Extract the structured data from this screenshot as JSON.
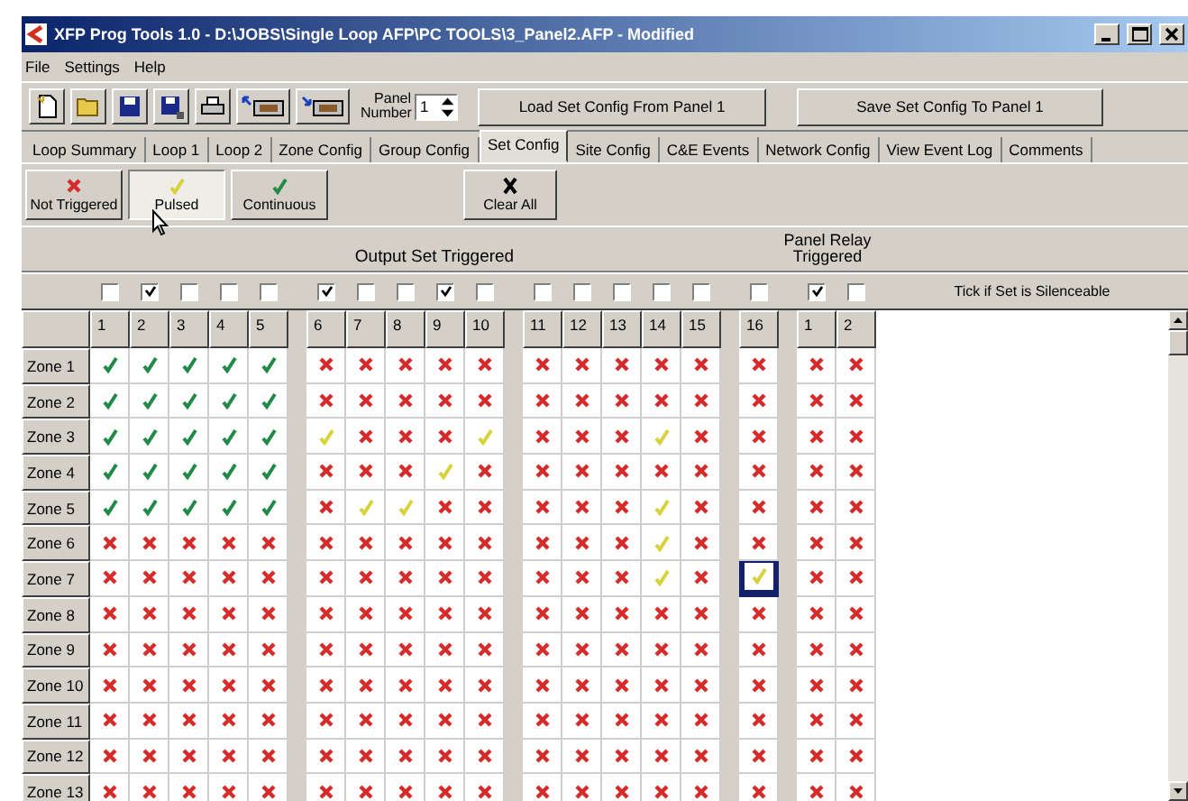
{
  "window": {
    "title": "XFP Prog Tools 1.0 - D:\\JOBS\\Single Loop AFP\\PC TOOLS\\3_Panel2.AFP - Modified"
  },
  "menu": [
    "File",
    "Settings",
    "Help"
  ],
  "toolbar": {
    "panel_number": {
      "label": "Panel Number",
      "value": "1"
    },
    "buttons": [
      "Load Set Config From Panel 1",
      "Save Set Config To Panel 1"
    ]
  },
  "tabs": [
    {
      "label": "Loop Summary",
      "selected": false
    },
    {
      "label": "Loop 1",
      "selected": false
    },
    {
      "label": "Loop 2",
      "selected": false
    },
    {
      "label": "Zone Config",
      "selected": false
    },
    {
      "label": "Group Config",
      "selected": false
    },
    {
      "label": "Set Config",
      "selected": true
    },
    {
      "label": "Site Config",
      "selected": false
    },
    {
      "label": "C&E Events",
      "selected": false
    },
    {
      "label": "Network Config",
      "selected": false
    },
    {
      "label": "View Event Log",
      "selected": false
    },
    {
      "label": "Comments",
      "selected": false
    }
  ],
  "mode_buttons": [
    {
      "label": "Not Triggered",
      "kind": "not_triggered",
      "selected": false
    },
    {
      "label": "Pulsed",
      "kind": "pulsed",
      "selected": true
    },
    {
      "label": "Continuous",
      "kind": "continuous",
      "selected": false
    }
  ],
  "clear_button": {
    "label": "Clear All"
  },
  "grid": {
    "output_heading": "Output Set Triggered",
    "relay_heading": "Panel Relay Triggered",
    "silence_label": "Tick if Set is Silenceable",
    "columns": [
      {
        "label": "1",
        "checked": false
      },
      {
        "label": "2",
        "checked": true
      },
      {
        "label": "3",
        "checked": false
      },
      {
        "label": "4",
        "checked": false
      },
      {
        "label": "5",
        "checked": false
      },
      {
        "label": "6",
        "checked": true
      },
      {
        "label": "7",
        "checked": false
      },
      {
        "label": "8",
        "checked": false
      },
      {
        "label": "9",
        "checked": true
      },
      {
        "label": "10",
        "checked": false
      },
      {
        "label": "11",
        "checked": false
      },
      {
        "label": "12",
        "checked": false
      },
      {
        "label": "13",
        "checked": false
      },
      {
        "label": "14",
        "checked": false
      },
      {
        "label": "15",
        "checked": false
      },
      {
        "label": "16",
        "checked": false
      },
      {
        "label": "1",
        "checked": true
      },
      {
        "label": "2",
        "checked": false
      }
    ],
    "rows": [
      {
        "label": "Zone 1",
        "cells": [
          {
            "kind": "continuous",
            "selected": false
          },
          {
            "kind": "continuous",
            "selected": false
          },
          {
            "kind": "continuous",
            "selected": false
          },
          {
            "kind": "continuous",
            "selected": false
          },
          {
            "kind": "continuous",
            "selected": false
          },
          {
            "kind": "not_triggered",
            "selected": false
          },
          {
            "kind": "not_triggered",
            "selected": false
          },
          {
            "kind": "not_triggered",
            "selected": false
          },
          {
            "kind": "not_triggered",
            "selected": false
          },
          {
            "kind": "not_triggered",
            "selected": false
          },
          {
            "kind": "not_triggered",
            "selected": false
          },
          {
            "kind": "not_triggered",
            "selected": false
          },
          {
            "kind": "not_triggered",
            "selected": false
          },
          {
            "kind": "not_triggered",
            "selected": false
          },
          {
            "kind": "not_triggered",
            "selected": false
          },
          {
            "kind": "not_triggered",
            "selected": false
          },
          {
            "kind": "not_triggered",
            "selected": false
          },
          {
            "kind": "not_triggered",
            "selected": false
          }
        ]
      },
      {
        "label": "Zone 2",
        "cells": [
          {
            "kind": "continuous",
            "selected": false
          },
          {
            "kind": "continuous",
            "selected": false
          },
          {
            "kind": "continuous",
            "selected": false
          },
          {
            "kind": "continuous",
            "selected": false
          },
          {
            "kind": "continuous",
            "selected": false
          },
          {
            "kind": "not_triggered",
            "selected": false
          },
          {
            "kind": "not_triggered",
            "selected": false
          },
          {
            "kind": "not_triggered",
            "selected": false
          },
          {
            "kind": "not_triggered",
            "selected": false
          },
          {
            "kind": "not_triggered",
            "selected": false
          },
          {
            "kind": "not_triggered",
            "selected": false
          },
          {
            "kind": "not_triggered",
            "selected": false
          },
          {
            "kind": "not_triggered",
            "selected": false
          },
          {
            "kind": "not_triggered",
            "selected": false
          },
          {
            "kind": "not_triggered",
            "selected": false
          },
          {
            "kind": "not_triggered",
            "selected": false
          },
          {
            "kind": "not_triggered",
            "selected": false
          },
          {
            "kind": "not_triggered",
            "selected": false
          }
        ]
      },
      {
        "label": "Zone 3",
        "cells": [
          {
            "kind": "continuous",
            "selected": false
          },
          {
            "kind": "continuous",
            "selected": false
          },
          {
            "kind": "continuous",
            "selected": false
          },
          {
            "kind": "continuous",
            "selected": false
          },
          {
            "kind": "continuous",
            "selected": false
          },
          {
            "kind": "pulsed",
            "selected": false
          },
          {
            "kind": "not_triggered",
            "selected": false
          },
          {
            "kind": "not_triggered",
            "selected": false
          },
          {
            "kind": "not_triggered",
            "selected": false
          },
          {
            "kind": "pulsed",
            "selected": false
          },
          {
            "kind": "not_triggered",
            "selected": false
          },
          {
            "kind": "not_triggered",
            "selected": false
          },
          {
            "kind": "not_triggered",
            "selected": false
          },
          {
            "kind": "pulsed",
            "selected": false
          },
          {
            "kind": "not_triggered",
            "selected": false
          },
          {
            "kind": "not_triggered",
            "selected": false
          },
          {
            "kind": "not_triggered",
            "selected": false
          },
          {
            "kind": "not_triggered",
            "selected": false
          }
        ]
      },
      {
        "label": "Zone 4",
        "cells": [
          {
            "kind": "continuous",
            "selected": false
          },
          {
            "kind": "continuous",
            "selected": false
          },
          {
            "kind": "continuous",
            "selected": false
          },
          {
            "kind": "continuous",
            "selected": false
          },
          {
            "kind": "continuous",
            "selected": false
          },
          {
            "kind": "not_triggered",
            "selected": false
          },
          {
            "kind": "not_triggered",
            "selected": false
          },
          {
            "kind": "not_triggered",
            "selected": false
          },
          {
            "kind": "pulsed",
            "selected": false
          },
          {
            "kind": "not_triggered",
            "selected": false
          },
          {
            "kind": "not_triggered",
            "selected": false
          },
          {
            "kind": "not_triggered",
            "selected": false
          },
          {
            "kind": "not_triggered",
            "selected": false
          },
          {
            "kind": "not_triggered",
            "selected": false
          },
          {
            "kind": "not_triggered",
            "selected": false
          },
          {
            "kind": "not_triggered",
            "selected": false
          },
          {
            "kind": "not_triggered",
            "selected": false
          },
          {
            "kind": "not_triggered",
            "selected": false
          }
        ]
      },
      {
        "label": "Zone 5",
        "cells": [
          {
            "kind": "continuous",
            "selected": false
          },
          {
            "kind": "continuous",
            "selected": false
          },
          {
            "kind": "continuous",
            "selected": false
          },
          {
            "kind": "continuous",
            "selected": false
          },
          {
            "kind": "continuous",
            "selected": false
          },
          {
            "kind": "not_triggered",
            "selected": false
          },
          {
            "kind": "pulsed",
            "selected": false
          },
          {
            "kind": "pulsed",
            "selected": false
          },
          {
            "kind": "not_triggered",
            "selected": false
          },
          {
            "kind": "not_triggered",
            "selected": false
          },
          {
            "kind": "not_triggered",
            "selected": false
          },
          {
            "kind": "not_triggered",
            "selected": false
          },
          {
            "kind": "not_triggered",
            "selected": false
          },
          {
            "kind": "pulsed",
            "selected": false
          },
          {
            "kind": "not_triggered",
            "selected": false
          },
          {
            "kind": "not_triggered",
            "selected": false
          },
          {
            "kind": "not_triggered",
            "selected": false
          },
          {
            "kind": "not_triggered",
            "selected": false
          }
        ]
      },
      {
        "label": "Zone 6",
        "cells": [
          {
            "kind": "not_triggered",
            "selected": false
          },
          {
            "kind": "not_triggered",
            "selected": false
          },
          {
            "kind": "not_triggered",
            "selected": false
          },
          {
            "kind": "not_triggered",
            "selected": false
          },
          {
            "kind": "not_triggered",
            "selected": false
          },
          {
            "kind": "not_triggered",
            "selected": false
          },
          {
            "kind": "not_triggered",
            "selected": false
          },
          {
            "kind": "not_triggered",
            "selected": false
          },
          {
            "kind": "not_triggered",
            "selected": false
          },
          {
            "kind": "not_triggered",
            "selected": false
          },
          {
            "kind": "not_triggered",
            "selected": false
          },
          {
            "kind": "not_triggered",
            "selected": false
          },
          {
            "kind": "not_triggered",
            "selected": false
          },
          {
            "kind": "pulsed",
            "selected": false
          },
          {
            "kind": "not_triggered",
            "selected": false
          },
          {
            "kind": "not_triggered",
            "selected": false
          },
          {
            "kind": "not_triggered",
            "selected": false
          },
          {
            "kind": "not_triggered",
            "selected": false
          }
        ]
      },
      {
        "label": "Zone 7",
        "cells": [
          {
            "kind": "not_triggered",
            "selected": false
          },
          {
            "kind": "not_triggered",
            "selected": false
          },
          {
            "kind": "not_triggered",
            "selected": false
          },
          {
            "kind": "not_triggered",
            "selected": false
          },
          {
            "kind": "not_triggered",
            "selected": false
          },
          {
            "kind": "not_triggered",
            "selected": false
          },
          {
            "kind": "not_triggered",
            "selected": false
          },
          {
            "kind": "not_triggered",
            "selected": false
          },
          {
            "kind": "not_triggered",
            "selected": false
          },
          {
            "kind": "not_triggered",
            "selected": false
          },
          {
            "kind": "not_triggered",
            "selected": false
          },
          {
            "kind": "not_triggered",
            "selected": false
          },
          {
            "kind": "not_triggered",
            "selected": false
          },
          {
            "kind": "pulsed",
            "selected": false
          },
          {
            "kind": "not_triggered",
            "selected": false
          },
          {
            "kind": "pulsed",
            "selected": true
          },
          {
            "kind": "not_triggered",
            "selected": false
          },
          {
            "kind": "not_triggered",
            "selected": false
          }
        ]
      },
      {
        "label": "Zone 8",
        "cells": [
          {
            "kind": "not_triggered",
            "selected": false
          },
          {
            "kind": "not_triggered",
            "selected": false
          },
          {
            "kind": "not_triggered",
            "selected": false
          },
          {
            "kind": "not_triggered",
            "selected": false
          },
          {
            "kind": "not_triggered",
            "selected": false
          },
          {
            "kind": "not_triggered",
            "selected": false
          },
          {
            "kind": "not_triggered",
            "selected": false
          },
          {
            "kind": "not_triggered",
            "selected": false
          },
          {
            "kind": "not_triggered",
            "selected": false
          },
          {
            "kind": "not_triggered",
            "selected": false
          },
          {
            "kind": "not_triggered",
            "selected": false
          },
          {
            "kind": "not_triggered",
            "selected": false
          },
          {
            "kind": "not_triggered",
            "selected": false
          },
          {
            "kind": "not_triggered",
            "selected": false
          },
          {
            "kind": "not_triggered",
            "selected": false
          },
          {
            "kind": "not_triggered",
            "selected": false
          },
          {
            "kind": "not_triggered",
            "selected": false
          },
          {
            "kind": "not_triggered",
            "selected": false
          }
        ]
      },
      {
        "label": "Zone 9",
        "cells": [
          {
            "kind": "not_triggered",
            "selected": false
          },
          {
            "kind": "not_triggered",
            "selected": false
          },
          {
            "kind": "not_triggered",
            "selected": false
          },
          {
            "kind": "not_triggered",
            "selected": false
          },
          {
            "kind": "not_triggered",
            "selected": false
          },
          {
            "kind": "not_triggered",
            "selected": false
          },
          {
            "kind": "not_triggered",
            "selected": false
          },
          {
            "kind": "not_triggered",
            "selected": false
          },
          {
            "kind": "not_triggered",
            "selected": false
          },
          {
            "kind": "not_triggered",
            "selected": false
          },
          {
            "kind": "not_triggered",
            "selected": false
          },
          {
            "kind": "not_triggered",
            "selected": false
          },
          {
            "kind": "not_triggered",
            "selected": false
          },
          {
            "kind": "not_triggered",
            "selected": false
          },
          {
            "kind": "not_triggered",
            "selected": false
          },
          {
            "kind": "not_triggered",
            "selected": false
          },
          {
            "kind": "not_triggered",
            "selected": false
          },
          {
            "kind": "not_triggered",
            "selected": false
          }
        ]
      },
      {
        "label": "Zone 10",
        "cells": [
          {
            "kind": "not_triggered",
            "selected": false
          },
          {
            "kind": "not_triggered",
            "selected": false
          },
          {
            "kind": "not_triggered",
            "selected": false
          },
          {
            "kind": "not_triggered",
            "selected": false
          },
          {
            "kind": "not_triggered",
            "selected": false
          },
          {
            "kind": "not_triggered",
            "selected": false
          },
          {
            "kind": "not_triggered",
            "selected": false
          },
          {
            "kind": "not_triggered",
            "selected": false
          },
          {
            "kind": "not_triggered",
            "selected": false
          },
          {
            "kind": "not_triggered",
            "selected": false
          },
          {
            "kind": "not_triggered",
            "selected": false
          },
          {
            "kind": "not_triggered",
            "selected": false
          },
          {
            "kind": "not_triggered",
            "selected": false
          },
          {
            "kind": "not_triggered",
            "selected": false
          },
          {
            "kind": "not_triggered",
            "selected": false
          },
          {
            "kind": "not_triggered",
            "selected": false
          },
          {
            "kind": "not_triggered",
            "selected": false
          },
          {
            "kind": "not_triggered",
            "selected": false
          }
        ]
      },
      {
        "label": "Zone 11",
        "cells": [
          {
            "kind": "not_triggered",
            "selected": false
          },
          {
            "kind": "not_triggered",
            "selected": false
          },
          {
            "kind": "not_triggered",
            "selected": false
          },
          {
            "kind": "not_triggered",
            "selected": false
          },
          {
            "kind": "not_triggered",
            "selected": false
          },
          {
            "kind": "not_triggered",
            "selected": false
          },
          {
            "kind": "not_triggered",
            "selected": false
          },
          {
            "kind": "not_triggered",
            "selected": false
          },
          {
            "kind": "not_triggered",
            "selected": false
          },
          {
            "kind": "not_triggered",
            "selected": false
          },
          {
            "kind": "not_triggered",
            "selected": false
          },
          {
            "kind": "not_triggered",
            "selected": false
          },
          {
            "kind": "not_triggered",
            "selected": false
          },
          {
            "kind": "not_triggered",
            "selected": false
          },
          {
            "kind": "not_triggered",
            "selected": false
          },
          {
            "kind": "not_triggered",
            "selected": false
          },
          {
            "kind": "not_triggered",
            "selected": false
          },
          {
            "kind": "not_triggered",
            "selected": false
          }
        ]
      },
      {
        "label": "Zone 12",
        "cells": [
          {
            "kind": "not_triggered",
            "selected": false
          },
          {
            "kind": "not_triggered",
            "selected": false
          },
          {
            "kind": "not_triggered",
            "selected": false
          },
          {
            "kind": "not_triggered",
            "selected": false
          },
          {
            "kind": "not_triggered",
            "selected": false
          },
          {
            "kind": "not_triggered",
            "selected": false
          },
          {
            "kind": "not_triggered",
            "selected": false
          },
          {
            "kind": "not_triggered",
            "selected": false
          },
          {
            "kind": "not_triggered",
            "selected": false
          },
          {
            "kind": "not_triggered",
            "selected": false
          },
          {
            "kind": "not_triggered",
            "selected": false
          },
          {
            "kind": "not_triggered",
            "selected": false
          },
          {
            "kind": "not_triggered",
            "selected": false
          },
          {
            "kind": "not_triggered",
            "selected": false
          },
          {
            "kind": "not_triggered",
            "selected": false
          },
          {
            "kind": "not_triggered",
            "selected": false
          },
          {
            "kind": "not_triggered",
            "selected": false
          },
          {
            "kind": "not_triggered",
            "selected": false
          }
        ]
      },
      {
        "label": "Zone 13",
        "cells": [
          {
            "kind": "not_triggered",
            "selected": false
          },
          {
            "kind": "not_triggered",
            "selected": false
          },
          {
            "kind": "not_triggered",
            "selected": false
          },
          {
            "kind": "not_triggered",
            "selected": false
          },
          {
            "kind": "not_triggered",
            "selected": false
          },
          {
            "kind": "not_triggered",
            "selected": false
          },
          {
            "kind": "not_triggered",
            "selected": false
          },
          {
            "kind": "not_triggered",
            "selected": false
          },
          {
            "kind": "not_triggered",
            "selected": false
          },
          {
            "kind": "not_triggered",
            "selected": false
          },
          {
            "kind": "not_triggered",
            "selected": false
          },
          {
            "kind": "not_triggered",
            "selected": false
          },
          {
            "kind": "not_triggered",
            "selected": false
          },
          {
            "kind": "not_triggered",
            "selected": false
          },
          {
            "kind": "not_triggered",
            "selected": false
          },
          {
            "kind": "not_triggered",
            "selected": false
          },
          {
            "kind": "not_triggered",
            "selected": false
          },
          {
            "kind": "not_triggered",
            "selected": false
          }
        ]
      }
    ]
  }
}
